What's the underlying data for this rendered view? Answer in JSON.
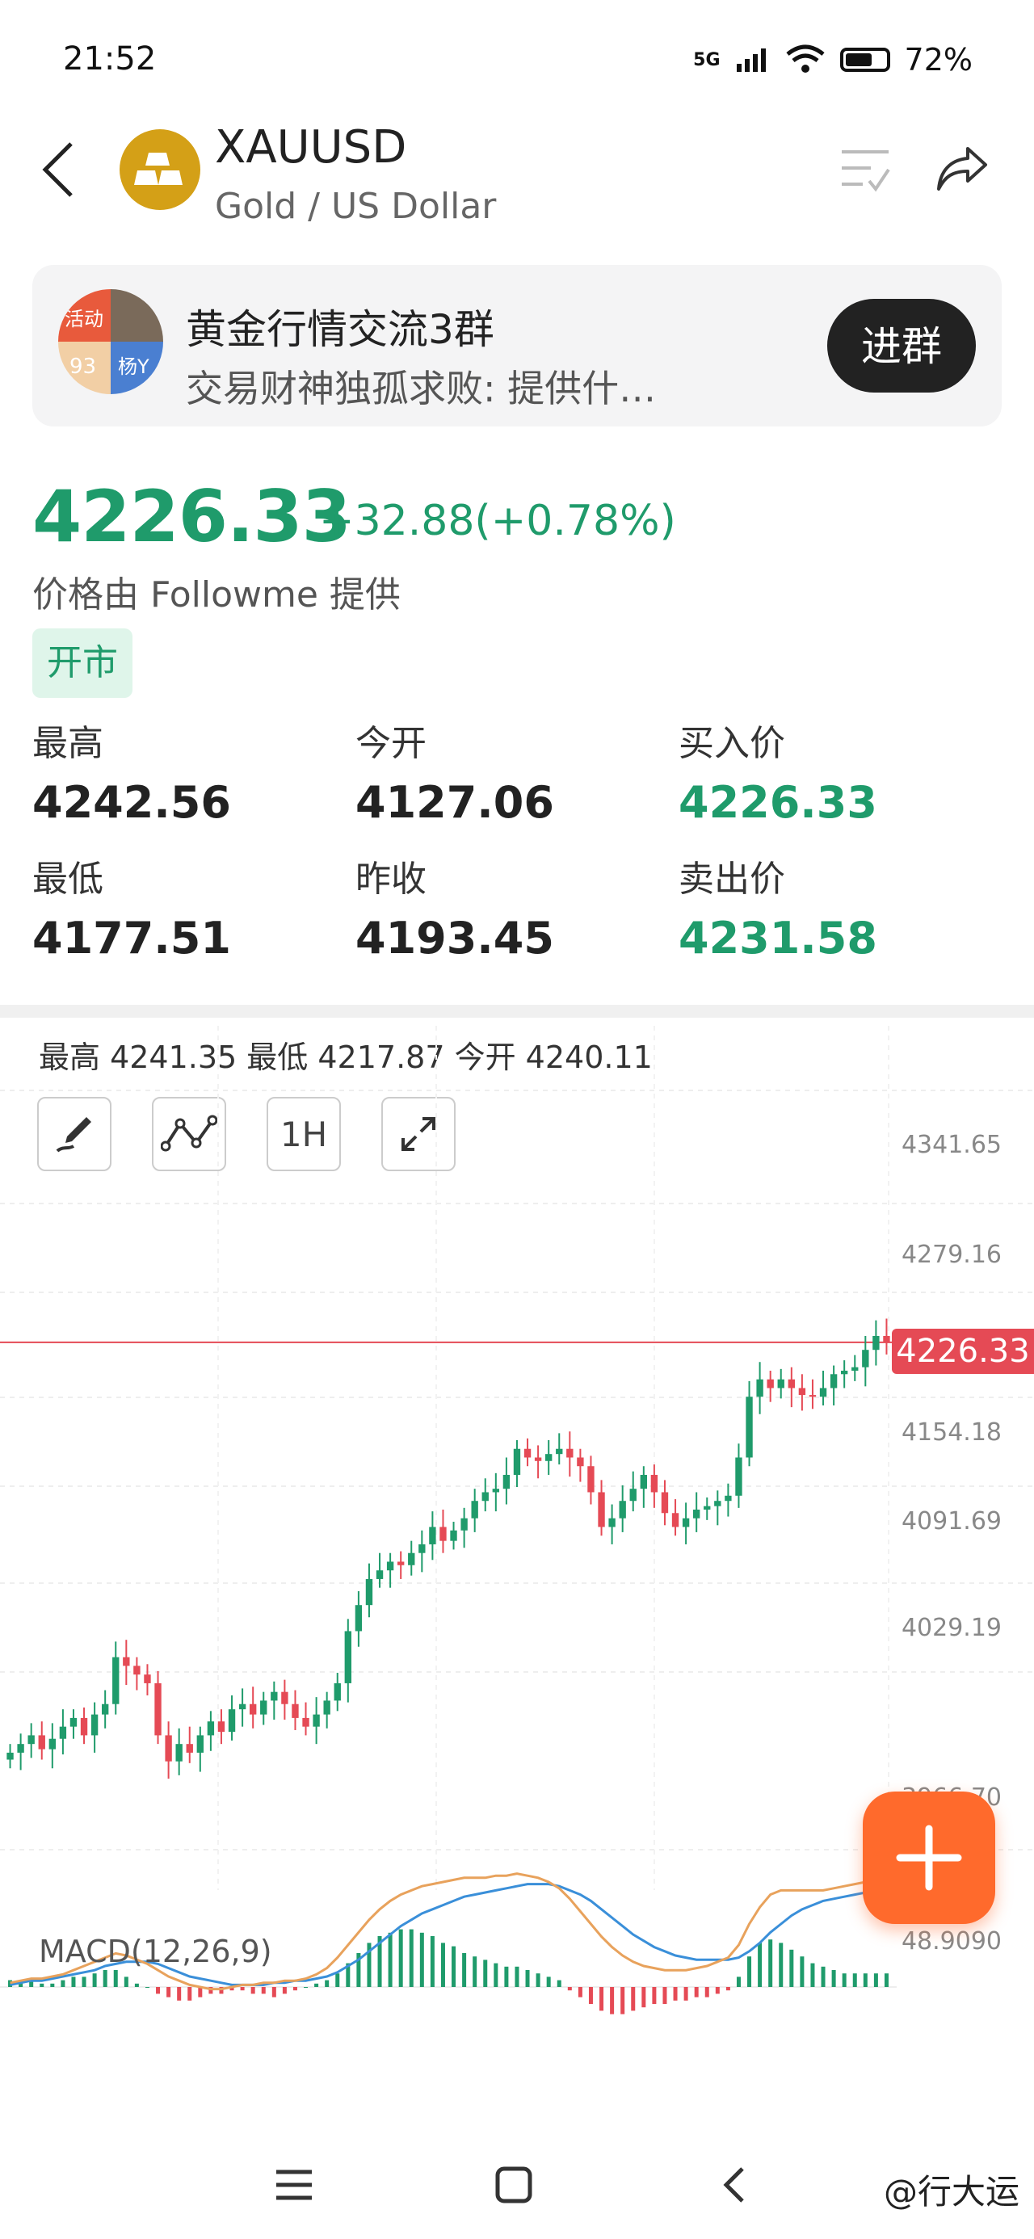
{
  "status_bar": {
    "time": "21:52",
    "network": "5G",
    "battery": "72%"
  },
  "header": {
    "symbol": "XAUUSD",
    "subtitle": "Gold / US Dollar"
  },
  "banner": {
    "title": "黄金行情交流3群",
    "message": "交易财神独孤求败: 提供什…",
    "join_label": "进群",
    "avatar_tags": [
      "活动",
      "93",
      "杨Y"
    ]
  },
  "quote": {
    "price": "4226.33",
    "change": "+32.88(+0.78%)",
    "provider": "价格由 Followme 提供",
    "market_status": "开市",
    "stats": [
      {
        "label": "最高",
        "value": "4242.56",
        "green": false
      },
      {
        "label": "今开",
        "value": "4127.06",
        "green": false
      },
      {
        "label": "买入价",
        "value": "4226.33",
        "green": true
      },
      {
        "label": "最低",
        "value": "4177.51",
        "green": false
      },
      {
        "label": "昨收",
        "value": "4193.45",
        "green": false
      },
      {
        "label": "卖出价",
        "value": "4231.58",
        "green": true
      }
    ]
  },
  "chart": {
    "info_text": "最高 4241.35  最低 4217.87  今开 4240.11",
    "interval": "1H",
    "current_price": "4226.33",
    "price_axis": [
      "4341.65",
      "4279.16",
      "4154.18",
      "4091.69",
      "4029.19",
      "3966.70",
      "48.9090"
    ],
    "macd_label": "MACD(12,26,9)"
  },
  "colors": {
    "up": "#1f9b6b",
    "down": "#e54a55",
    "accent": "#ff6a2c"
  },
  "watermark": "@行大运",
  "chart_data": {
    "type": "line",
    "title": "",
    "ylim": [
      3966.7,
      4341.65
    ],
    "y_ticks": [
      4341.65,
      4279.16,
      4154.18,
      4091.69,
      4029.19,
      3966.7
    ],
    "close": [
      3990,
      3995,
      4000,
      3992,
      3998,
      4005,
      4010,
      4000,
      4012,
      4018,
      4045,
      4040,
      4035,
      4030,
      4000,
      3985,
      3995,
      3990,
      4000,
      4008,
      4002,
      4015,
      4018,
      4012,
      4020,
      4025,
      4018,
      4010,
      4005,
      4012,
      4020,
      4030,
      4060,
      4075,
      4090,
      4095,
      4100,
      4098,
      4105,
      4110,
      4120,
      4112,
      4118,
      4125,
      4135,
      4140,
      4142,
      4150,
      4165,
      4160,
      4158,
      4162,
      4165,
      4160,
      4155,
      4140,
      4120,
      4125,
      4135,
      4142,
      4150,
      4140,
      4128,
      4120,
      4125,
      4130,
      4132,
      4135,
      4138,
      4160,
      4195,
      4205,
      4200,
      4205,
      4200,
      4196,
      4195,
      4200,
      4208,
      4210,
      4212,
      4222,
      4230,
      4226.33
    ],
    "macd_hist": [
      2,
      2,
      2,
      1,
      1,
      2,
      3,
      3,
      4,
      5,
      5,
      3,
      1,
      0,
      -2,
      -3,
      -4,
      -4,
      -3,
      -2,
      -2,
      -1,
      -1,
      -2,
      -2,
      -3,
      -2,
      -1,
      0,
      1,
      2,
      4,
      7,
      10,
      13,
      15,
      16,
      17,
      17,
      16,
      15,
      13,
      12,
      10,
      9,
      8,
      7,
      6,
      6,
      5,
      4,
      3,
      2,
      -1,
      -3,
      -5,
      -7,
      -8,
      -8,
      -7,
      -6,
      -5,
      -5,
      -4,
      -4,
      -3,
      -3,
      -2,
      -1,
      3,
      9,
      13,
      14,
      13,
      11,
      9,
      7,
      6,
      5,
      4,
      4,
      4,
      4,
      4
    ],
    "macd_dif": [
      2,
      3,
      4,
      4,
      5,
      6,
      8,
      10,
      12,
      14,
      16,
      15,
      13,
      11,
      8,
      5,
      3,
      1,
      0,
      -1,
      -1,
      0,
      1,
      1,
      2,
      2,
      3,
      3,
      4,
      6,
      9,
      14,
      20,
      26,
      32,
      37,
      41,
      44,
      46,
      48,
      49,
      50,
      51,
      52,
      52,
      52,
      53,
      53,
      54,
      53,
      52,
      50,
      47,
      42,
      36,
      30,
      24,
      19,
      15,
      12,
      10,
      9,
      8,
      8,
      8,
      9,
      10,
      12,
      14,
      20,
      30,
      38,
      44,
      46,
      46,
      46,
      46,
      46,
      47,
      48,
      49,
      50,
      51,
      52
    ],
    "macd_dea": [
      1,
      2,
      3,
      3,
      4,
      5,
      6,
      7,
      8,
      10,
      11,
      12,
      12,
      12,
      11,
      9,
      7,
      5,
      4,
      3,
      2,
      1,
      1,
      1,
      1,
      2,
      2,
      3,
      3,
      4,
      5,
      7,
      10,
      13,
      17,
      21,
      25,
      29,
      32,
      35,
      37,
      39,
      41,
      43,
      44,
      45,
      46,
      47,
      48,
      49,
      49,
      49,
      48,
      46,
      44,
      41,
      37,
      33,
      29,
      25,
      22,
      19,
      17,
      15,
      14,
      13,
      13,
      13,
      13,
      14,
      17,
      21,
      26,
      30,
      34,
      37,
      39,
      41,
      42,
      43,
      44,
      45,
      46,
      47
    ]
  }
}
